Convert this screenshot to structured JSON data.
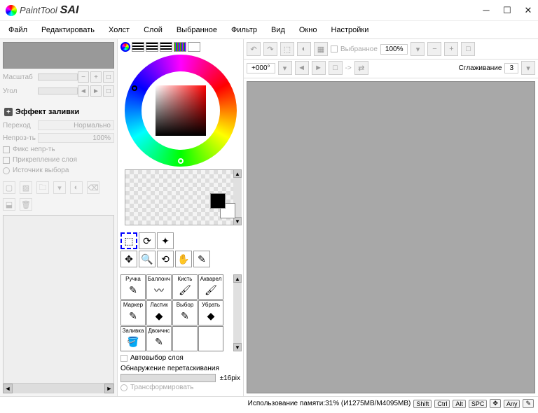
{
  "title": {
    "paint": "PaintTool",
    "sai": "SAI"
  },
  "menubar": [
    "Файл",
    "Редактировать",
    "Холст",
    "Слой",
    "Выбранное",
    "Фильтр",
    "Вид",
    "Окно",
    "Настройки"
  ],
  "left": {
    "scale_label": "Масштаб",
    "angle_label": "Угол",
    "fill_effect": "Эффект заливки",
    "blend_label": "Переход",
    "blend_value": "Нормально",
    "opacity_label": "Непроз-ть",
    "opacity_value": "100%",
    "fix_opacity": "Фикс непр-ть",
    "clip_layer": "Прикрепление слоя",
    "selection_src": "Источник выбора"
  },
  "mid": {
    "auto_layer": "Автовыбор слоя",
    "drag_detect": "Обнаружение перетаскивания",
    "drag_value": "±16pix",
    "transform": "Трансформировать",
    "brushes": [
      "Ручка",
      "Баллонч",
      "Кисть",
      "Акварел",
      "Маркер",
      "Ластик",
      "Выбор",
      "Убрать",
      "Заливка",
      "Двоичнс"
    ]
  },
  "topbar": {
    "selected": "Выбранное",
    "zoom": "100%",
    "angle": "+000°",
    "arrow": "->",
    "smooth_label": "Сглаживание",
    "smooth_value": "3"
  },
  "status": {
    "mem": "Использование памяти:31% (И1275MB/M4095MB)",
    "keys": [
      "Shift",
      "Ctrl",
      "Alt",
      "SPC",
      "✥",
      "Any",
      "✎"
    ]
  }
}
